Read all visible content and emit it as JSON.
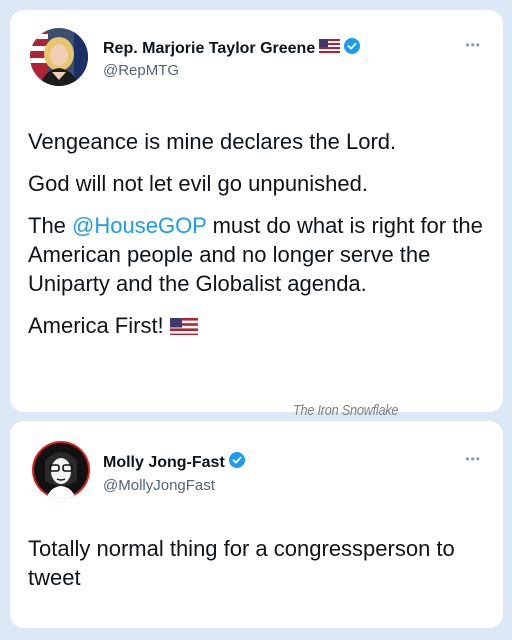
{
  "tweet_1": {
    "display_name": "Rep. Marjorie Taylor Greene",
    "handle": "@RepMTG",
    "more_icon": "more-horizontal-icon",
    "verified": true,
    "paragraphs": [
      "Vengeance is mine declares the Lord.",
      "God will not let evil go unpunished."
    ],
    "p3_prefix": "The ",
    "p3_mention": "@HouseGOP",
    "p3_suffix": " must do what is right for the American people and no longer serve the Uniparty and the Globalist agenda.",
    "closing": "America First!",
    "closing_icon": "us-flag-icon"
  },
  "tweet_2": {
    "display_name": "Molly Jong-Fast",
    "handle": "@MollyJongFast",
    "more_icon": "more-horizontal-icon",
    "verified": true,
    "text": "Totally normal thing for a congressperson to tweet"
  },
  "watermark": "The Iron Snowflake",
  "colors": {
    "background": "#dbe9f7",
    "card": "#ffffff",
    "text": "#0f1419",
    "secondary_text": "#536471",
    "link": "#1d9bf0",
    "verified": "#1d9bf0"
  }
}
